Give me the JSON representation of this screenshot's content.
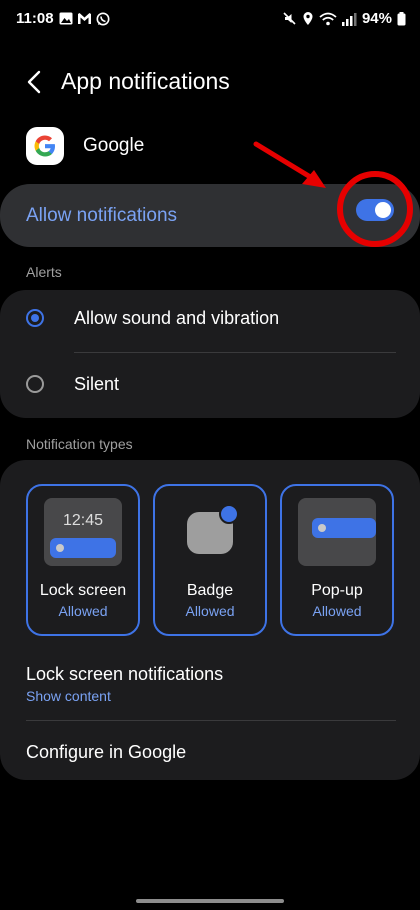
{
  "status_bar": {
    "time": "11:08",
    "left_icons": [
      "gallery-icon",
      "gmail-icon",
      "whatsapp-icon"
    ],
    "right_icons": [
      "mute-icon",
      "location-icon",
      "wifi-icon",
      "signal-icon"
    ],
    "battery": "94%"
  },
  "header": {
    "title": "App notifications"
  },
  "app": {
    "name": "Google"
  },
  "allow": {
    "label": "Allow notifications",
    "enabled": true
  },
  "alerts": {
    "header": "Alerts",
    "options": [
      {
        "label": "Allow sound and vibration",
        "selected": true
      },
      {
        "label": "Silent",
        "selected": false
      }
    ]
  },
  "types": {
    "header": "Notification types",
    "tiles": [
      {
        "name": "Lock screen",
        "status": "Allowed",
        "preview_time": "12:45"
      },
      {
        "name": "Badge",
        "status": "Allowed"
      },
      {
        "name": "Pop-up",
        "status": "Allowed"
      }
    ],
    "lock_screen_notifications": {
      "title": "Lock screen notifications",
      "value": "Show content"
    },
    "configure": {
      "label": "Configure in Google"
    }
  },
  "colors": {
    "accent": "#3e73e6",
    "accent_text": "#7aa2f3",
    "annotation": "#e60000"
  }
}
